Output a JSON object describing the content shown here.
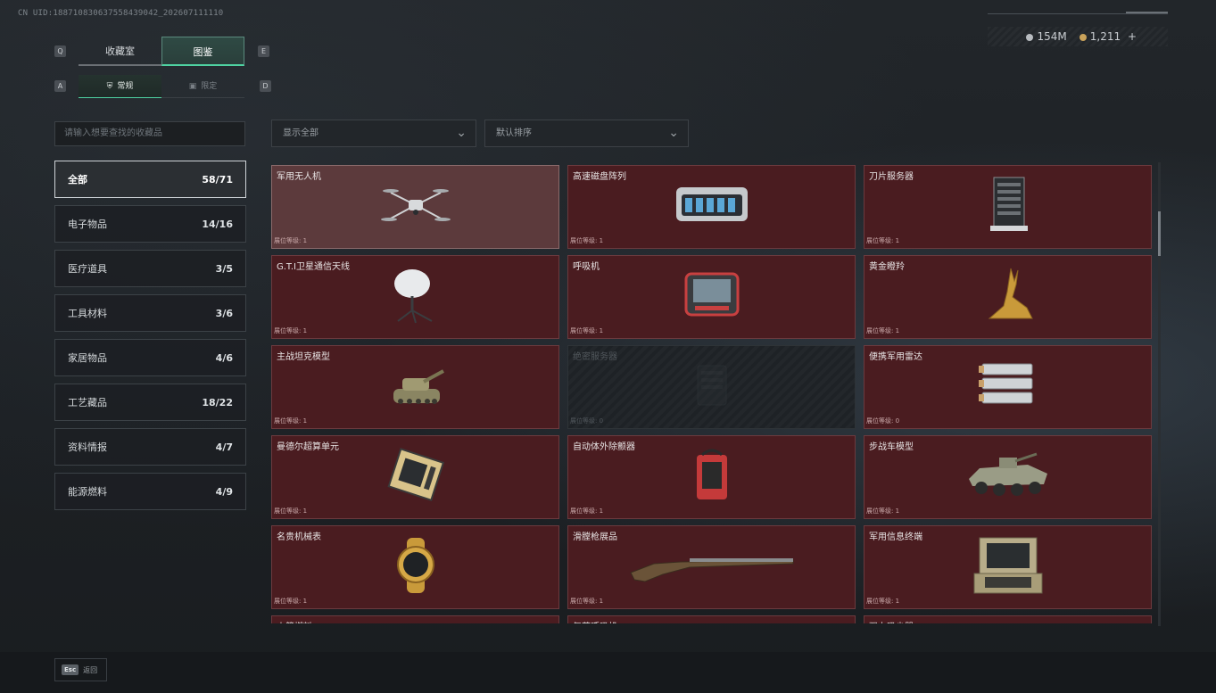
{
  "uid": "CN UID:18871083063755843904​2_202607111110",
  "top_tabs": {
    "left_key": "Q",
    "right_key": "E",
    "items": [
      {
        "label": "收藏室",
        "active": false
      },
      {
        "label": "图鉴",
        "active": true
      }
    ]
  },
  "sub_tabs": {
    "left_key": "A",
    "right_key": "D",
    "items": [
      {
        "label": "常规",
        "icon": "bell-icon",
        "active": true
      },
      {
        "label": "限定",
        "icon": "frame-icon",
        "active": false
      }
    ]
  },
  "currency": {
    "silver": "154M",
    "gold": "1,211",
    "add": "+"
  },
  "search": {
    "placeholder": "请输入想要查找的收藏品"
  },
  "filters": {
    "display": "显示全部",
    "sort": "默认排序"
  },
  "categories": [
    {
      "label": "全部",
      "count": "58/71",
      "active": true
    },
    {
      "label": "电子物品",
      "count": "14/16"
    },
    {
      "label": "医疗道具",
      "count": "3/5"
    },
    {
      "label": "工具材料",
      "count": "3/6"
    },
    {
      "label": "家居物品",
      "count": "4/6"
    },
    {
      "label": "工艺藏品",
      "count": "18/22"
    },
    {
      "label": "资料情报",
      "count": "4/7"
    },
    {
      "label": "能源燃料",
      "count": "4/9"
    }
  ],
  "items": [
    {
      "name": "军用无人机",
      "level": "展位等级: 1",
      "art": "drone-icon",
      "selected": true
    },
    {
      "name": "高速磁盘阵列",
      "level": "展位等级: 1",
      "art": "disk-array-icon"
    },
    {
      "name": "刀片服务器",
      "level": "展位等级: 1",
      "art": "blade-server-icon"
    },
    {
      "name": "G.T.I卫星通信天线",
      "level": "展位等级: 1",
      "art": "satellite-dish-icon"
    },
    {
      "name": "呼吸机",
      "level": "展位等级: 1",
      "art": "ventilator-icon"
    },
    {
      "name": "黄金瞪羚",
      "level": "展位等级: 1",
      "art": "golden-gazelle-icon"
    },
    {
      "name": "主战坦克模型",
      "level": "展位等级: 1",
      "art": "tank-icon"
    },
    {
      "name": "绝密服务器",
      "level": "展位等级: 0",
      "art": "secret-server-icon",
      "locked": true
    },
    {
      "name": "便携军用雷达",
      "level": "展位等级: 0",
      "art": "radar-icon"
    },
    {
      "name": "曼德尔超算单元",
      "level": "展位等级: 1",
      "art": "supercomputer-unit-icon"
    },
    {
      "name": "自动体外除颤器",
      "level": "展位等级: 1",
      "art": "defibrillator-icon"
    },
    {
      "name": "步战车模型",
      "level": "展位等级: 1",
      "art": "ifv-icon"
    },
    {
      "name": "名贵机械表",
      "level": "展位等级: 1",
      "art": "watch-icon"
    },
    {
      "name": "滑膛枪展品",
      "level": "展位等级: 1",
      "art": "musket-icon"
    },
    {
      "name": "军用信息终端",
      "level": "展位等级: 1",
      "art": "terminal-icon"
    },
    {
      "name": "火箭燃料",
      "level": "",
      "art": "rocket-fuel-icon"
    },
    {
      "name": "复苏呼吸机",
      "level": "",
      "art": "resuscitator-icon"
    },
    {
      "name": "强力吸尘器",
      "level": "",
      "art": "vacuum-icon"
    }
  ],
  "footer": {
    "esc_key": "Esc",
    "esc_label": "返回"
  }
}
